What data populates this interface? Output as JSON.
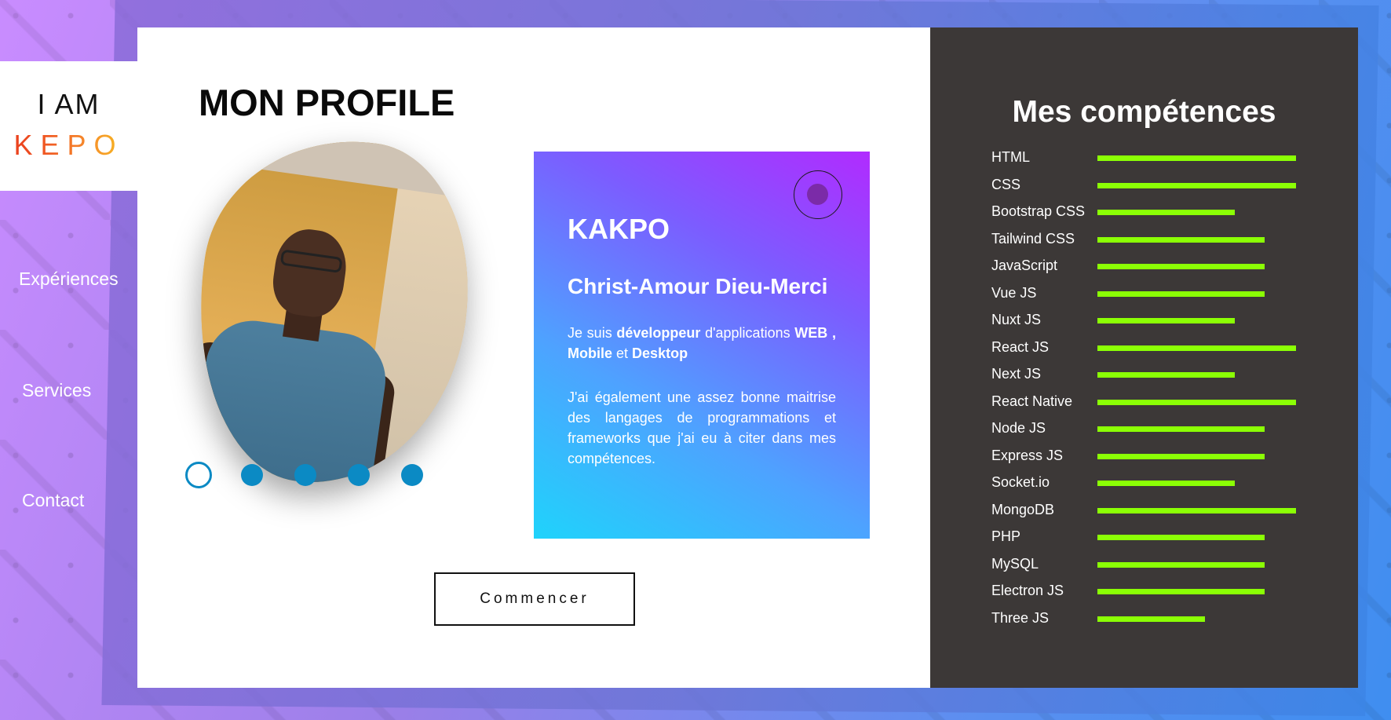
{
  "logo": {
    "top": "I AM",
    "bottom": "KEPO"
  },
  "nav": {
    "experiences": "Expériences",
    "services": "Services",
    "contact": "Contact"
  },
  "profile": {
    "title": "MON PROFILE",
    "start_button": "Commencer",
    "carousel": {
      "count": 5,
      "active_index": 0
    }
  },
  "info": {
    "nickname": "KAKPO",
    "name": "Christ-Amour Dieu-Merci",
    "p1_prefix": "Je suis",
    "p1_bold1": "développeur",
    "p1_mid": "d'applications",
    "p1_bold2": "WEB",
    "p1_sep": ",",
    "p1_bold3": "Mobile",
    "p1_and": "et",
    "p1_bold4": "Desktop",
    "p2": "J'ai également une assez bonne maitrise des langages de programmations et frameworks que j'ai eu à citer dans mes compétences."
  },
  "skills": {
    "title": "Mes compétences",
    "bar_color": "#8bff05",
    "items": [
      {
        "name": "HTML",
        "level": 1.0
      },
      {
        "name": "CSS",
        "level": 1.0
      },
      {
        "name": "Bootstrap CSS",
        "level": 0.69
      },
      {
        "name": "Tailwind CSS",
        "level": 0.84
      },
      {
        "name": "JavaScript",
        "level": 0.84
      },
      {
        "name": "Vue JS",
        "level": 0.84
      },
      {
        "name": "Nuxt JS",
        "level": 0.69
      },
      {
        "name": "React JS",
        "level": 1.0
      },
      {
        "name": "Next JS",
        "level": 0.69
      },
      {
        "name": "React Native",
        "level": 1.0
      },
      {
        "name": "Node JS",
        "level": 0.84
      },
      {
        "name": "Express JS",
        "level": 0.84
      },
      {
        "name": "Socket.io",
        "level": 0.69
      },
      {
        "name": "MongoDB",
        "level": 1.0
      },
      {
        "name": "PHP",
        "level": 0.84
      },
      {
        "name": "MySQL",
        "level": 0.84
      },
      {
        "name": "Electron JS",
        "level": 0.84
      },
      {
        "name": "Three JS",
        "level": 0.54
      }
    ]
  }
}
